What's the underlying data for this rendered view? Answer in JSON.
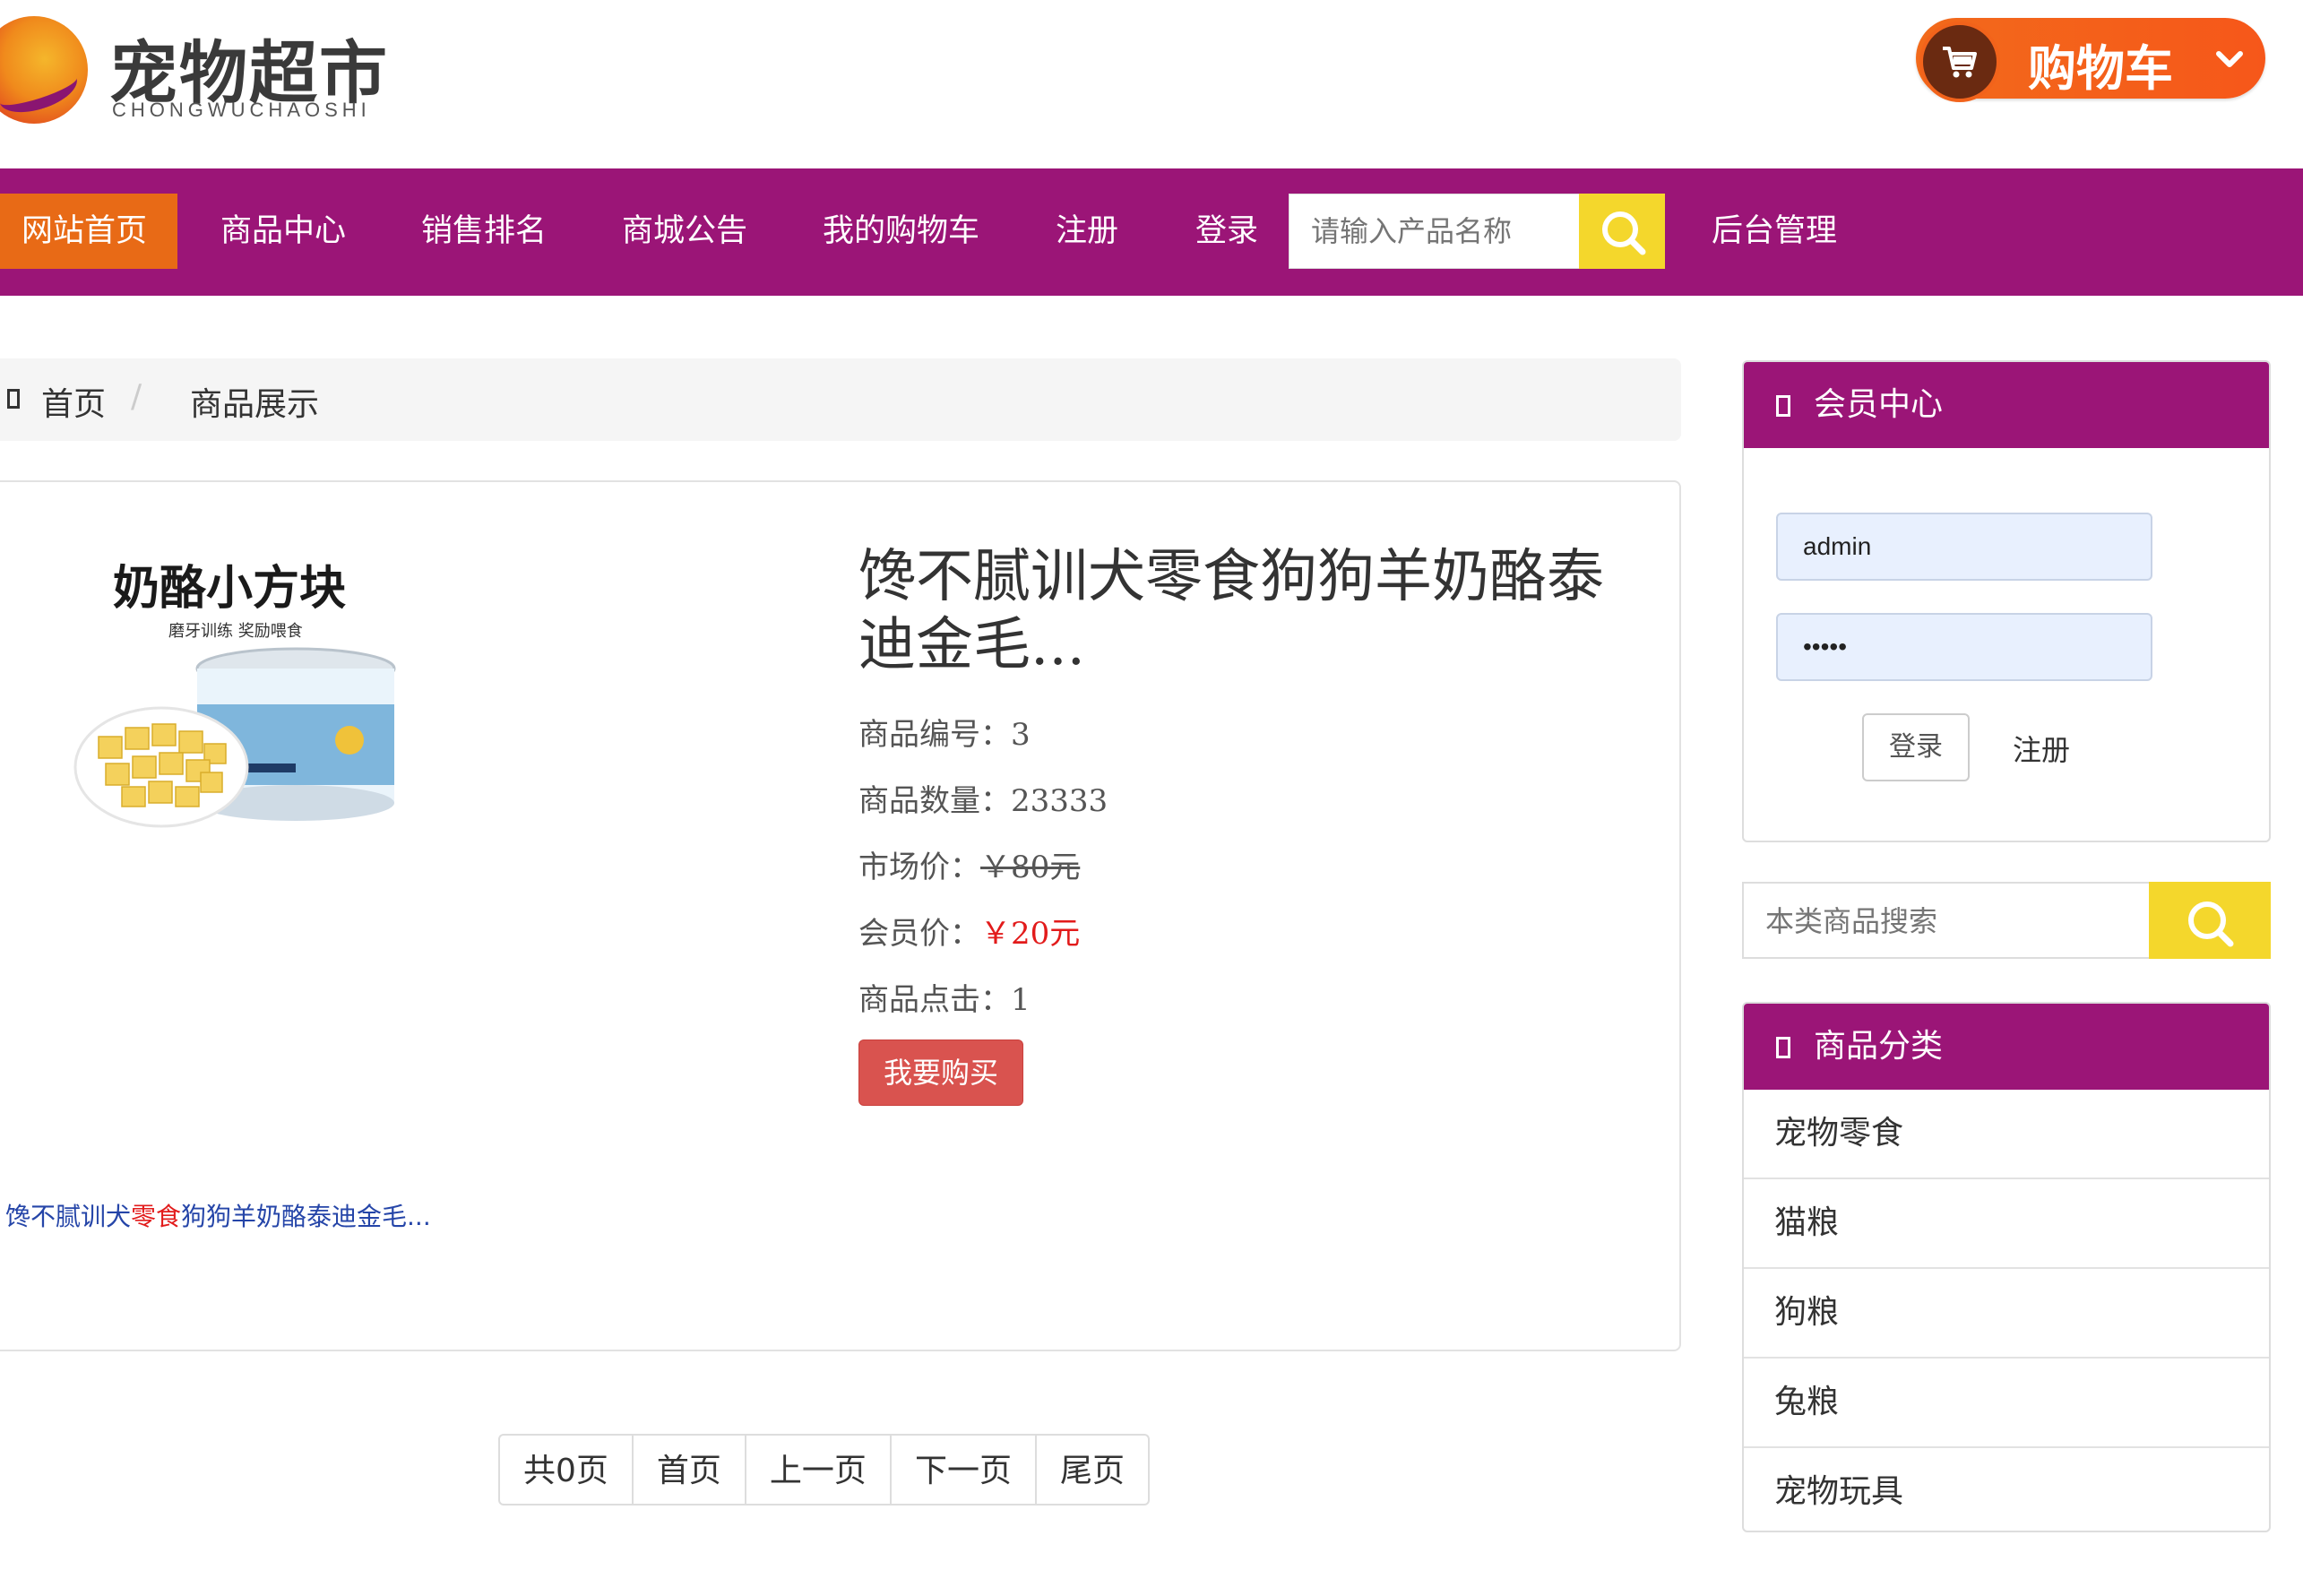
{
  "header": {
    "logo_title": "宠物超市",
    "logo_subtitle": "CHONGWUCHAOSHI",
    "cart_label": "购物车"
  },
  "nav": {
    "items": [
      "网站首页",
      "商品中心",
      "销售排名",
      "商城公告",
      "我的购物车",
      "注册",
      "登录"
    ],
    "search_placeholder": "请输入产品名称",
    "admin_label": "后台管理"
  },
  "breadcrumb": {
    "home": "首页",
    "separator": "/",
    "current": "商品展示"
  },
  "product": {
    "image_text_main": "奶酪小方块",
    "image_text_sub": "磨牙训练 奖励喂食",
    "title": "馋不腻训犬零食狗狗羊奶酪泰迪金毛...",
    "id_label": "商品编号：",
    "id_value": "3",
    "qty_label": "商品数量：",
    "qty_value": "23333",
    "market_label": "市场价：",
    "market_value": "￥80元",
    "member_label": "会员价：",
    "member_value": "￥20元",
    "clicks_label": "商品点击：",
    "clicks_value": "1",
    "buy_label": "我要购买",
    "link_pre": "馋不腻训犬",
    "link_highlight": "零食",
    "link_post": "狗狗羊奶酪泰迪金毛..."
  },
  "pagination": [
    "共0页",
    "首页",
    "上一页",
    "下一页",
    "尾页"
  ],
  "member_center": {
    "title": "会员中心",
    "username": "admin",
    "password": "•••••",
    "login_label": "登录",
    "register_label": "注册"
  },
  "side_search": {
    "placeholder": "本类商品搜索"
  },
  "categories": {
    "title": "商品分类",
    "items": [
      "宠物零食",
      "猫粮",
      "狗粮",
      "兔粮",
      "宠物玩具"
    ]
  },
  "colors": {
    "nav_bg": "#9b1577",
    "nav_active": "#e86a16",
    "search_btn": "#f4d72c",
    "cart_btn": "#f26a1b",
    "buy_btn": "#d9534f",
    "price_red": "#e21b1b"
  }
}
